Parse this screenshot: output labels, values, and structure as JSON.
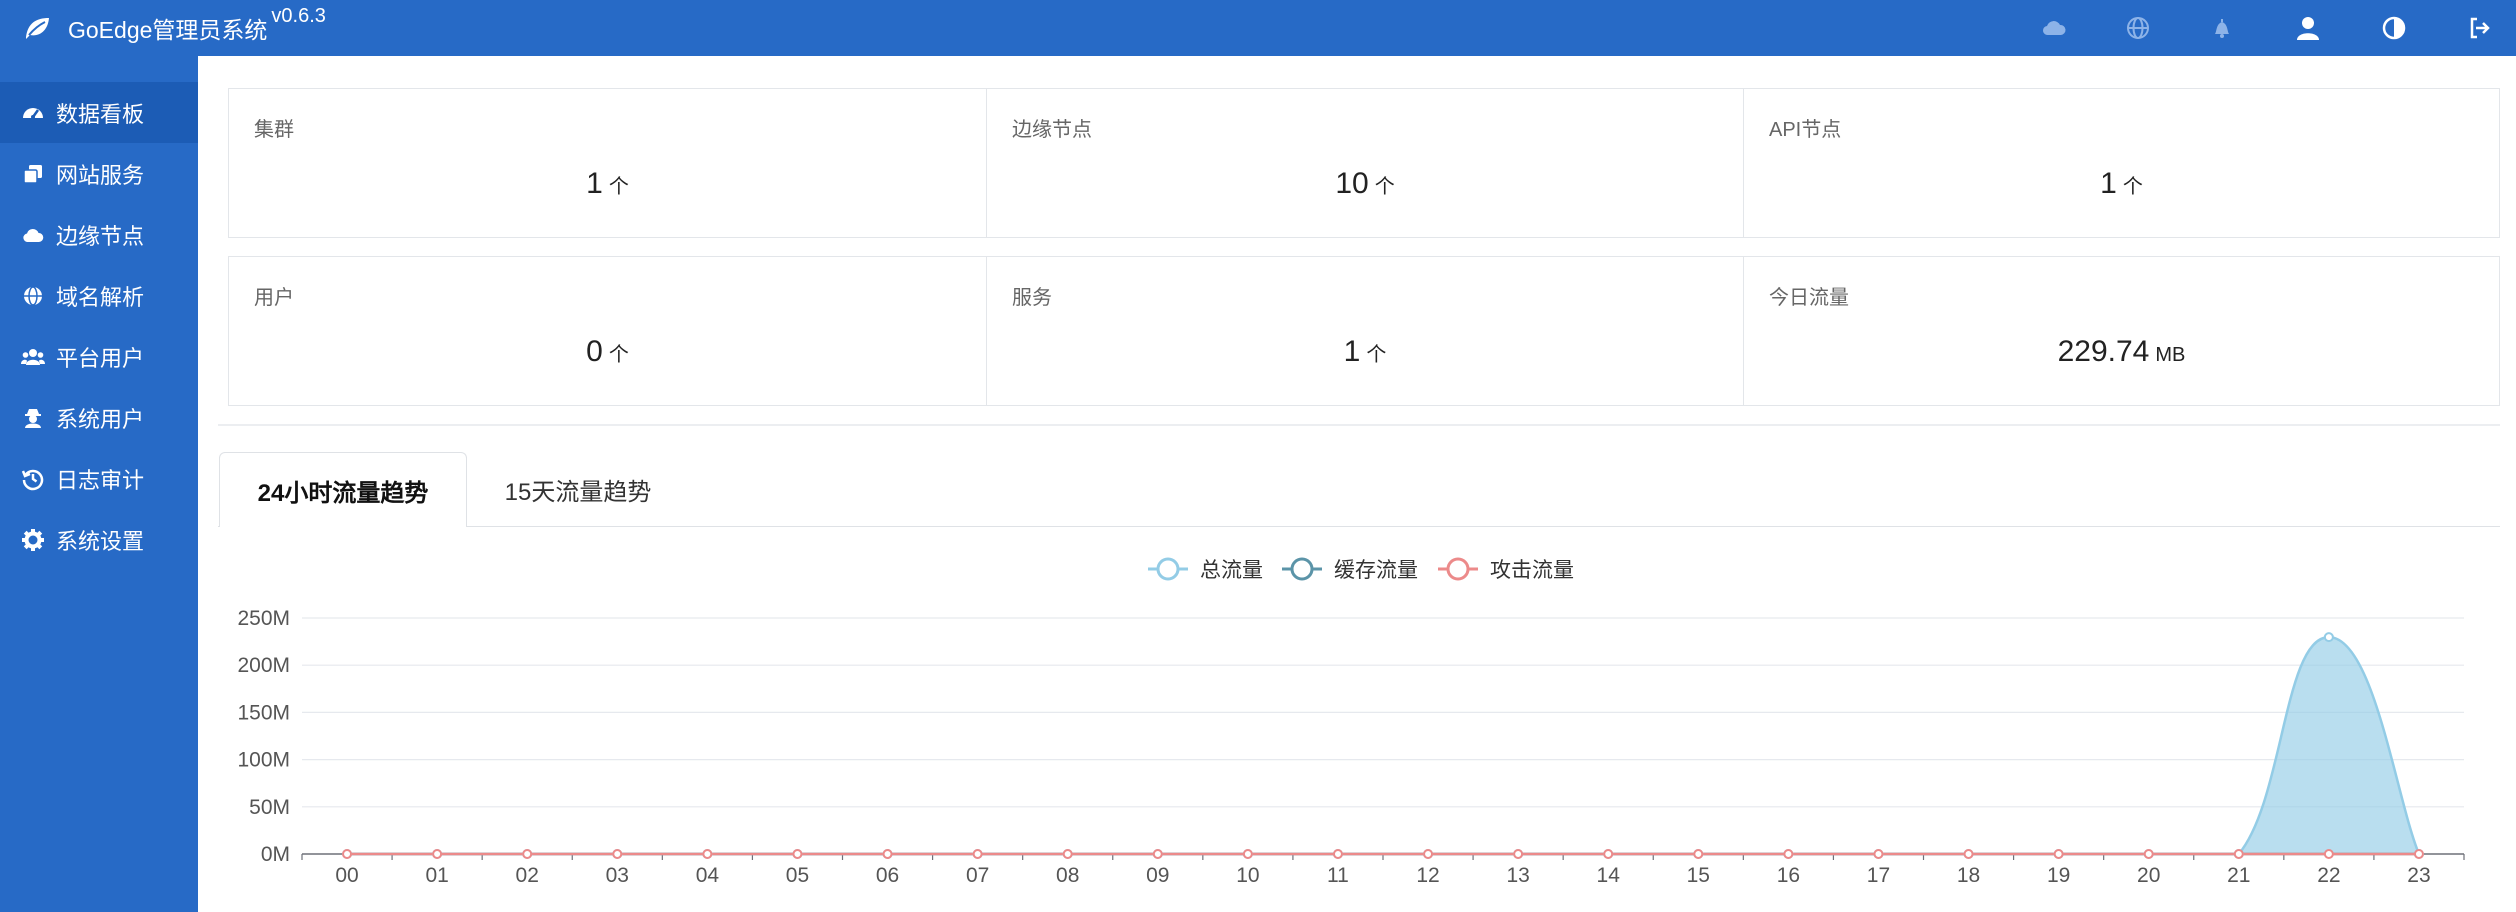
{
  "header": {
    "app_name": "GoEdge管理员系统",
    "version": "v0.6.3",
    "logo_icon": "leaf-icon",
    "icons": [
      "cloud-icon",
      "globe-icon",
      "bell-icon",
      "user-icon",
      "theme-toggle-icon",
      "logout-icon"
    ]
  },
  "sidebar": {
    "items": [
      {
        "label": "数据看板",
        "icon": "dashboard-icon",
        "active": true
      },
      {
        "label": "网站服务",
        "icon": "clone-icon"
      },
      {
        "label": "边缘节点",
        "icon": "cloud-icon"
      },
      {
        "label": "域名解析",
        "icon": "globe-icon"
      },
      {
        "label": "平台用户",
        "icon": "users-icon"
      },
      {
        "label": "系统用户",
        "icon": "user-secret-icon"
      },
      {
        "label": "日志审计",
        "icon": "history-icon"
      },
      {
        "label": "系统设置",
        "icon": "gear-icon"
      }
    ]
  },
  "stats": {
    "row1": [
      {
        "label": "集群",
        "value": "1",
        "unit": "个"
      },
      {
        "label": "边缘节点",
        "value": "10",
        "unit": "个"
      },
      {
        "label": "API节点",
        "value": "1",
        "unit": "个"
      }
    ],
    "row2": [
      {
        "label": "用户",
        "value": "0",
        "unit": "个"
      },
      {
        "label": "服务",
        "value": "1",
        "unit": "个"
      },
      {
        "label": "今日流量",
        "value": "229.74",
        "unit": "MB"
      }
    ]
  },
  "tabs": [
    {
      "label": "24小时流量趋势",
      "active": true
    },
    {
      "label": "15天流量趋势",
      "active": false
    }
  ],
  "colors": {
    "primary": "#276ac6",
    "sidebar_active": "#1c5cb5",
    "total_traffic": "#93cce6",
    "cached_traffic": "#5b94a8",
    "attack_traffic": "#ec8a8a"
  },
  "chart_data": {
    "type": "area",
    "legend_position": "top-center",
    "grid": true,
    "categories": [
      "00",
      "01",
      "02",
      "03",
      "04",
      "05",
      "06",
      "07",
      "08",
      "09",
      "10",
      "11",
      "12",
      "13",
      "14",
      "15",
      "16",
      "17",
      "18",
      "19",
      "20",
      "21",
      "22",
      "23"
    ],
    "ytick_labels": [
      "0M",
      "50M",
      "100M",
      "150M",
      "200M",
      "250M"
    ],
    "ylim": [
      0,
      250
    ],
    "series": [
      {
        "name": "总流量",
        "values": [
          0,
          0,
          0,
          0,
          0,
          0,
          0,
          0,
          0,
          0,
          0,
          0,
          0,
          0,
          0,
          0,
          0,
          0,
          0,
          0,
          0,
          0,
          229.74,
          0
        ]
      },
      {
        "name": "缓存流量",
        "values": [
          0,
          0,
          0,
          0,
          0,
          0,
          0,
          0,
          0,
          0,
          0,
          0,
          0,
          0,
          0,
          0,
          0,
          0,
          0,
          0,
          0,
          0,
          0,
          0
        ]
      },
      {
        "name": "攻击流量",
        "values": [
          0,
          0,
          0,
          0,
          0,
          0,
          0,
          0,
          0,
          0,
          0,
          0,
          0,
          0,
          0,
          0,
          0,
          0,
          0,
          0,
          0,
          0,
          0,
          0
        ]
      }
    ]
  }
}
